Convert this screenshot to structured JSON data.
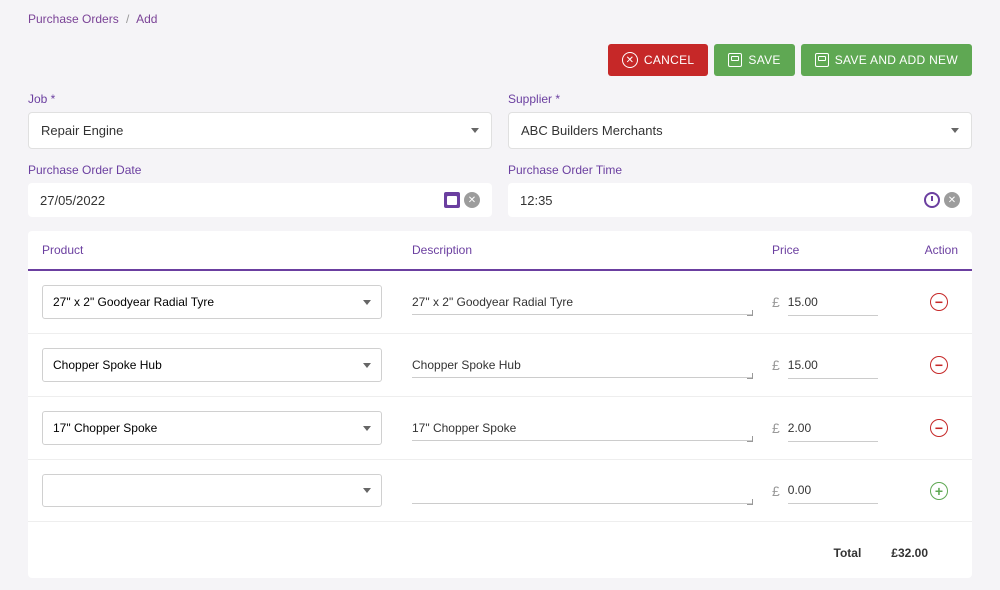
{
  "breadcrumb": {
    "parent": "Purchase Orders",
    "current": "Add"
  },
  "toolbar": {
    "cancel": "CANCEL",
    "save": "SAVE",
    "savenew": "SAVE AND ADD NEW"
  },
  "form": {
    "job_label": "Job *",
    "job_value": "Repair Engine",
    "supplier_label": "Supplier *",
    "supplier_value": "ABC Builders Merchants",
    "date_label": "Purchase Order Date",
    "date_value": "27/05/2022",
    "time_label": "Purchase Order Time",
    "time_value": "12:35"
  },
  "columns": {
    "product": "Product",
    "description": "Description",
    "price": "Price",
    "action": "Action"
  },
  "currency": "£",
  "rows": [
    {
      "product": "27\" x 2\" Goodyear Radial Tyre",
      "description": "27\" x 2\" Goodyear Radial Tyre",
      "price": "15.00",
      "action": "remove"
    },
    {
      "product": "Chopper Spoke Hub",
      "description": "Chopper Spoke Hub",
      "price": "15.00",
      "action": "remove"
    },
    {
      "product": "17\" Chopper Spoke",
      "description": "17\" Chopper Spoke",
      "price": "2.00",
      "action": "remove"
    },
    {
      "product": "",
      "description": "",
      "price": "0.00",
      "action": "add"
    }
  ],
  "total": {
    "label": "Total",
    "value": "£32.00"
  }
}
